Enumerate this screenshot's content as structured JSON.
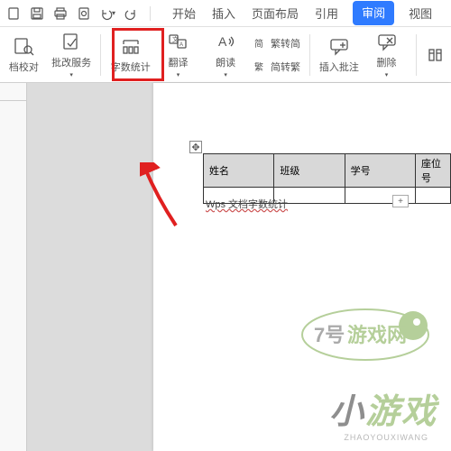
{
  "tabs": {
    "start": "开始",
    "insert": "插入",
    "layout": "页面布局",
    "ref": "引用",
    "review": "审阅",
    "view": "视图"
  },
  "ribbon": {
    "proofread": "档校对",
    "approve": "批改服务",
    "wordcount": "字数统计",
    "translate": "翻译",
    "read": "朗读",
    "simp": "繁转简",
    "trad": "简转繁",
    "insertcomment": "插入批注",
    "delete": "删除"
  },
  "table": {
    "h1": "姓名",
    "h2": "班级",
    "h3": "学号",
    "h4": "座位号"
  },
  "doc": {
    "caption": "Wps 文档字数统计"
  },
  "watermark": {
    "brand1": "7号",
    "brand2": "游戏网",
    "game": "游戏",
    "url": "ZHAOYOUXIWANG"
  }
}
